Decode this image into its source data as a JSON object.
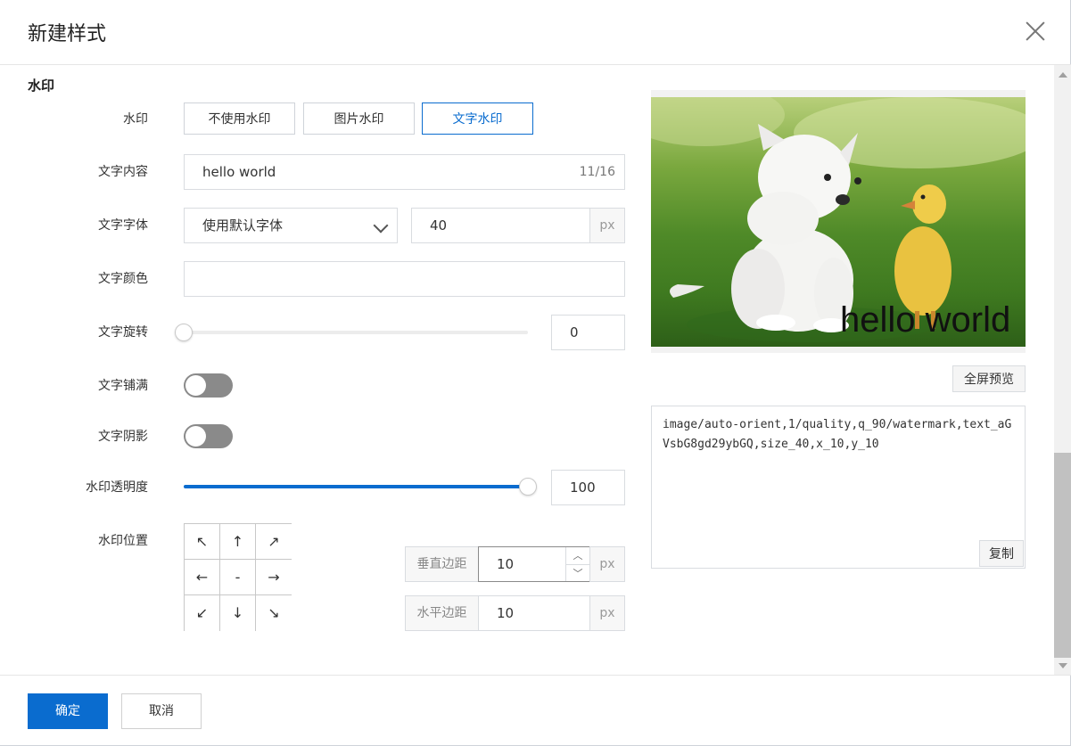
{
  "dialog": {
    "title": "新建样式"
  },
  "section": {
    "title": "水印"
  },
  "labels": {
    "watermark": "水印",
    "text_content": "文字内容",
    "text_font": "文字字体",
    "text_color": "文字颜色",
    "text_rotation": "文字旋转",
    "text_fill": "文字铺满",
    "text_shadow": "文字阴影",
    "opacity": "水印透明度",
    "position": "水印位置"
  },
  "watermark_tabs": [
    {
      "label": "不使用水印",
      "active": false
    },
    {
      "label": "图片水印",
      "active": false
    },
    {
      "label": "文字水印",
      "active": true
    }
  ],
  "text_content": {
    "value": "hello world",
    "counter": "11/16"
  },
  "font": {
    "selected": "使用默认字体",
    "size": "40",
    "unit": "px"
  },
  "color": {
    "value": ""
  },
  "rotation": {
    "value": "0",
    "fraction": 0
  },
  "fill_toggle": {
    "on": false
  },
  "shadow_toggle": {
    "on": false
  },
  "opacity": {
    "value": "100",
    "fraction": 1.0
  },
  "position_grid": [
    "↖",
    "↑",
    "↗",
    "←",
    "-",
    "→",
    "↙",
    "↓",
    "↘"
  ],
  "vertical_margin": {
    "label": "垂直边距",
    "value": "10",
    "unit": "px"
  },
  "horizontal_margin": {
    "label": "水平边距",
    "value": "10",
    "unit": "px"
  },
  "preview": {
    "watermark_text": "hello world",
    "fullscreen_label": "全屏预览"
  },
  "code": {
    "text": "image/auto-orient,1/quality,q_90/watermark,text_aGVsbG8gd29ybGQ,size_40,x_10,y_10",
    "copy_label": "复制"
  },
  "footer": {
    "confirm": "确定",
    "cancel": "取消"
  },
  "colors": {
    "accent": "#0a6ccf",
    "toggle_off": "#8a8a8a"
  }
}
